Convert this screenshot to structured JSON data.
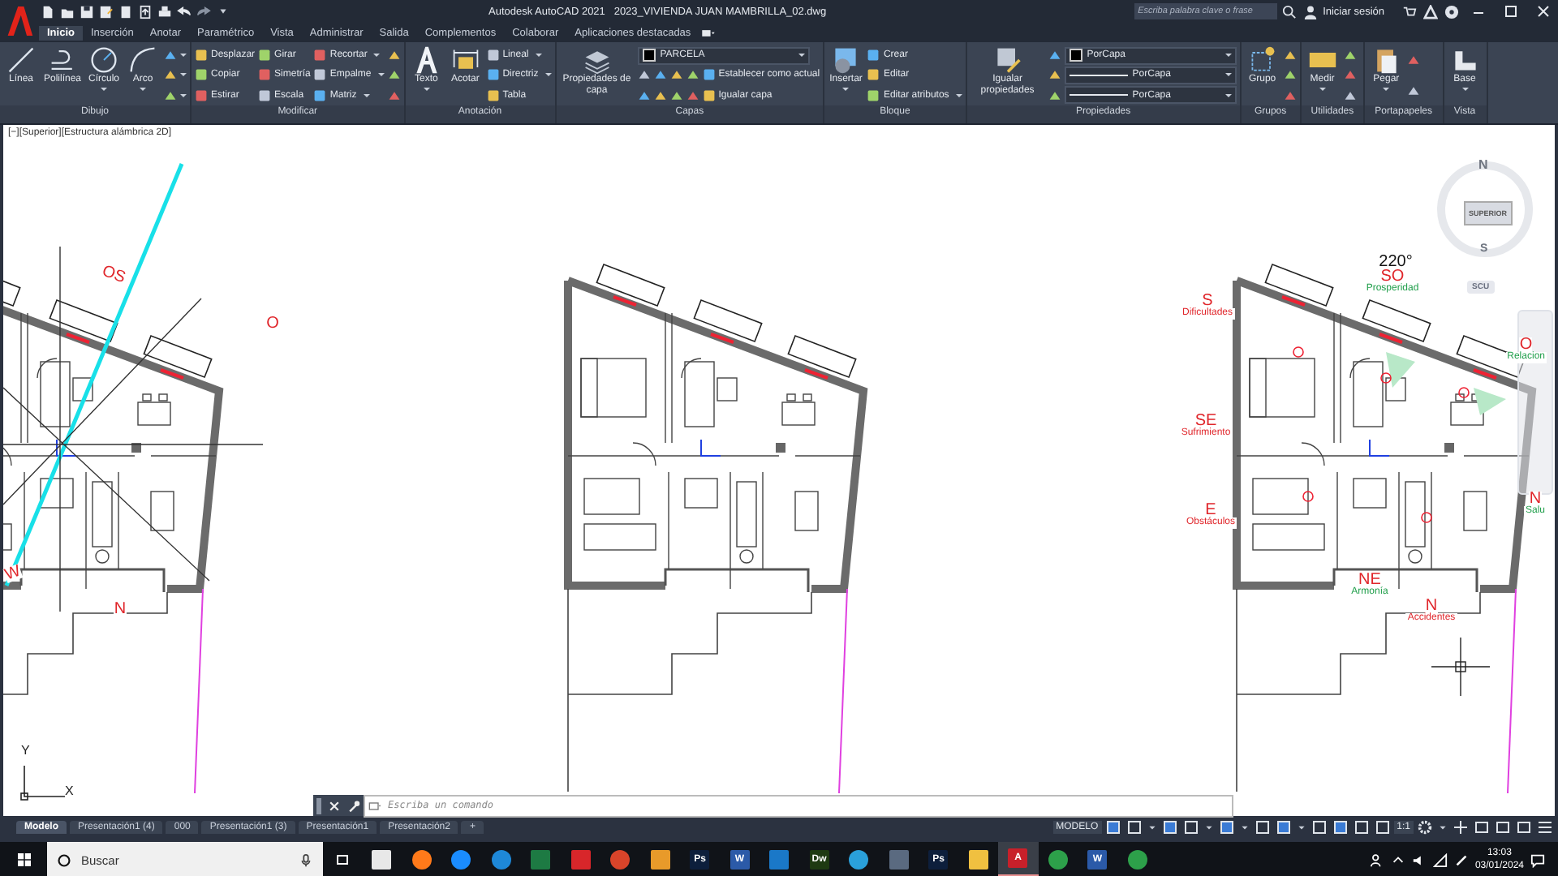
{
  "title_bar": {
    "app": "Autodesk AutoCAD 2021",
    "file": "2023_VIVIENDA JUAN MAMBRILLA_02.dwg",
    "search_placeholder": "Escriba palabra clave o frase",
    "sign_in": "Iniciar sesión"
  },
  "tabs": [
    {
      "label": "Inicio",
      "selected": true
    },
    {
      "label": "Inserción",
      "selected": false
    },
    {
      "label": "Anotar",
      "selected": false
    },
    {
      "label": "Paramétrico",
      "selected": false
    },
    {
      "label": "Vista",
      "selected": false
    },
    {
      "label": "Administrar",
      "selected": false
    },
    {
      "label": "Salida",
      "selected": false
    },
    {
      "label": "Complementos",
      "selected": false
    },
    {
      "label": "Colaborar",
      "selected": false
    },
    {
      "label": "Aplicaciones destacadas",
      "selected": false
    }
  ],
  "panels": [
    {
      "title": "Dibujo",
      "columns": [
        {
          "kind": "large",
          "label": "Línea",
          "caret": false
        },
        {
          "kind": "large",
          "label": "Polilínea",
          "caret": false
        },
        {
          "kind": "large",
          "label": "Círculo",
          "caret": true
        },
        {
          "kind": "large",
          "label": "Arco",
          "caret": true
        },
        {
          "kind": "stack",
          "rows": [
            [
              {
                "kind": "icon",
                "caret": true
              }
            ],
            [
              {
                "kind": "icon",
                "caret": true
              }
            ],
            [
              {
                "kind": "icon",
                "caret": true
              }
            ]
          ]
        }
      ]
    },
    {
      "title": "Modificar",
      "columns": [
        {
          "kind": "stack",
          "rows": [
            [
              {
                "kind": "tool",
                "label": "Desplazar",
                "caret": false
              }
            ],
            [
              {
                "kind": "tool",
                "label": "Copiar",
                "caret": false
              }
            ],
            [
              {
                "kind": "tool",
                "label": "Estirar",
                "caret": false
              }
            ]
          ]
        },
        {
          "kind": "stack",
          "rows": [
            [
              {
                "kind": "tool",
                "label": "Girar",
                "caret": false
              }
            ],
            [
              {
                "kind": "tool",
                "label": "Simetría",
                "caret": false
              }
            ],
            [
              {
                "kind": "tool",
                "label": "Escala",
                "caret": false
              }
            ]
          ]
        },
        {
          "kind": "stack",
          "rows": [
            [
              {
                "kind": "tool",
                "label": "Recortar",
                "caret": true
              }
            ],
            [
              {
                "kind": "tool",
                "label": "Empalme",
                "caret": true
              }
            ],
            [
              {
                "kind": "tool",
                "label": "Matriz",
                "caret": true
              }
            ]
          ]
        },
        {
          "kind": "stack",
          "rows": [
            [
              {
                "kind": "icon",
                "caret": false
              }
            ],
            [
              {
                "kind": "icon",
                "caret": false
              }
            ],
            [
              {
                "kind": "icon",
                "caret": false
              }
            ]
          ]
        }
      ]
    },
    {
      "title": "Anotación",
      "columns": [
        {
          "kind": "large",
          "label": "Texto",
          "caret": true
        },
        {
          "kind": "large",
          "label": "Acotar",
          "caret": false
        },
        {
          "kind": "stack",
          "rows": [
            [
              {
                "kind": "tool",
                "label": "Lineal",
                "caret": true
              }
            ],
            [
              {
                "kind": "tool",
                "label": "Directriz",
                "caret": true
              }
            ],
            [
              {
                "kind": "tool",
                "label": "Tabla",
                "caret": false
              }
            ]
          ]
        }
      ]
    },
    {
      "title": "Capas",
      "columns": [
        {
          "kind": "large",
          "label": "Propiedades de capa",
          "caret": false
        },
        {
          "kind": "stack",
          "rows": [
            [
              {
                "kind": "dropdown",
                "value": "PARCELA",
                "swatch": true,
                "line": false
              }
            ],
            [
              {
                "kind": "icon",
                "caret": false
              },
              {
                "kind": "icon",
                "caret": false
              },
              {
                "kind": "icon",
                "caret": false
              },
              {
                "kind": "icon",
                "caret": false
              },
              {
                "kind": "tool",
                "label": "Establecer como actual",
                "caret": false
              }
            ],
            [
              {
                "kind": "icon",
                "caret": false
              },
              {
                "kind": "icon",
                "caret": false
              },
              {
                "kind": "icon",
                "caret": false
              },
              {
                "kind": "icon",
                "caret": false
              },
              {
                "kind": "tool",
                "label": "Igualar capa",
                "caret": false
              }
            ]
          ]
        }
      ]
    },
    {
      "title": "Bloque",
      "columns": [
        {
          "kind": "large",
          "label": "Insertar",
          "caret": true
        },
        {
          "kind": "stack",
          "rows": [
            [
              {
                "kind": "tool",
                "label": "Crear",
                "caret": false
              }
            ],
            [
              {
                "kind": "tool",
                "label": "Editar",
                "caret": false
              }
            ],
            [
              {
                "kind": "tool",
                "label": "Editar atributos",
                "caret": true
              }
            ]
          ]
        }
      ]
    },
    {
      "title": "Propiedades",
      "columns": [
        {
          "kind": "large",
          "label": "Igualar propiedades",
          "caret": false
        },
        {
          "kind": "stack",
          "rows": [
            [
              {
                "kind": "icon",
                "caret": false
              },
              {
                "kind": "dropdown",
                "value": "PorCapa",
                "swatch": true,
                "line": false
              }
            ],
            [
              {
                "kind": "icon",
                "caret": false
              },
              {
                "kind": "dropdown",
                "value": "PorCapa",
                "swatch": false,
                "line": true
              }
            ],
            [
              {
                "kind": "icon",
                "caret": false
              },
              {
                "kind": "dropdown",
                "value": "PorCapa",
                "swatch": false,
                "line": true
              }
            ]
          ]
        }
      ]
    },
    {
      "title": "Grupos",
      "columns": [
        {
          "kind": "large",
          "label": "Grupo",
          "caret": false
        },
        {
          "kind": "stack",
          "rows": [
            [
              {
                "kind": "icon",
                "caret": false
              }
            ],
            [
              {
                "kind": "icon",
                "caret": false
              }
            ],
            [
              {
                "kind": "icon",
                "caret": false
              }
            ]
          ]
        }
      ]
    },
    {
      "title": "Utilidades",
      "columns": [
        {
          "kind": "large",
          "label": "Medir",
          "caret": true
        },
        {
          "kind": "stack",
          "rows": [
            [
              {
                "kind": "icon",
                "caret": false
              }
            ],
            [
              {
                "kind": "icon",
                "caret": false
              }
            ],
            [
              {
                "kind": "icon",
                "caret": false
              }
            ]
          ]
        }
      ]
    },
    {
      "title": "Portapapeles",
      "columns": [
        {
          "kind": "large",
          "label": "Pegar",
          "caret": true
        },
        {
          "kind": "stack",
          "rows": [
            [
              {
                "kind": "icon",
                "caret": false
              }
            ],
            [
              {
                "kind": "icon",
                "caret": false
              }
            ]
          ]
        }
      ]
    },
    {
      "title": "Vista",
      "columns": [
        {
          "kind": "large",
          "label": "Base",
          "caret": true
        }
      ]
    }
  ],
  "drawing": {
    "viewport_label": "[−][Superior][Estructura alámbrica 2D]",
    "left_plan": {
      "labels": [
        {
          "text": "OS",
          "color": "#e0262b"
        },
        {
          "text": "O",
          "color": "#e0262b"
        },
        {
          "text": "N",
          "color": "#e0262b"
        },
        {
          "text": "W",
          "color": "#e0262b"
        }
      ]
    },
    "right_plan": {
      "labels": [
        {
          "text": "220°",
          "color": "#111111"
        },
        {
          "text": "SO",
          "sub": "Prosperidad",
          "color": "#1f9e4a"
        },
        {
          "text": "S",
          "sub": "Dificultades",
          "color": "#e0262b"
        },
        {
          "text": "SE",
          "sub": "Sufrimiento",
          "color": "#e0262b"
        },
        {
          "text": "E",
          "sub": "Obstáculos",
          "color": "#e0262b"
        },
        {
          "text": "NE",
          "sub": "Armonía",
          "color": "#1f9e4a"
        },
        {
          "text": "N",
          "sub": "Accidentes",
          "color": "#e0262b"
        },
        {
          "text": "O",
          "sub": "Relacion",
          "color": "#1f9e4a"
        },
        {
          "text": "N",
          "sub": "Salu",
          "color": "#1f9e4a"
        }
      ]
    },
    "viewcube": {
      "north": "N",
      "face": "SUPERIOR",
      "south": "S",
      "ucs": "SCU"
    },
    "ucs_icon": {
      "y": "Y",
      "x": "X"
    },
    "command_line": {
      "placeholder": "Escriba un comando"
    }
  },
  "layout_tabs": [
    {
      "label": "Modelo",
      "selected": true
    },
    {
      "label": "Presentación1 (4)",
      "selected": false
    },
    {
      "label": "000",
      "selected": false
    },
    {
      "label": "Presentación1 (3)",
      "selected": false
    },
    {
      "label": "Presentación1",
      "selected": false
    },
    {
      "label": "Presentación2",
      "selected": false
    }
  ],
  "add_tab": "+",
  "status_bar": {
    "model": "MODELO",
    "scale": "1:1"
  },
  "taskbar": {
    "search_placeholder": "Buscar",
    "apps": [
      {
        "kind": "tile",
        "color": "#e8e8e8",
        "active": false
      },
      {
        "kind": "round",
        "color": "#ff7a1a",
        "active": false
      },
      {
        "kind": "round",
        "color": "#1a8cff",
        "active": false
      },
      {
        "kind": "round",
        "color": "#1e88d8",
        "active": false
      },
      {
        "kind": "tile",
        "color": "#1d7a43",
        "active": false
      },
      {
        "kind": "tile",
        "color": "#d8262a",
        "active": false
      },
      {
        "kind": "round",
        "color": "#d8442a",
        "active": false
      },
      {
        "kind": "tile",
        "color": "#e89a2a",
        "active": false
      },
      {
        "kind": "tile",
        "color": "#0d1f3c",
        "label": "Ps",
        "active": false
      },
      {
        "kind": "tile",
        "color": "#2b5aa8",
        "label": "W",
        "active": false
      },
      {
        "kind": "tile",
        "color": "#1a78c8",
        "active": false
      },
      {
        "kind": "tile",
        "color": "#1e3a12",
        "label": "Dw",
        "active": false
      },
      {
        "kind": "round",
        "color": "#2aa0da",
        "active": false
      },
      {
        "kind": "tile",
        "color": "#5a6a80",
        "active": false
      },
      {
        "kind": "tile",
        "color": "#0d1f3c",
        "label": "Ps",
        "active": false
      },
      {
        "kind": "tile",
        "color": "#f0c040",
        "active": false
      },
      {
        "kind": "tile",
        "color": "#c8202a",
        "label": "A",
        "active": true
      },
      {
        "kind": "round",
        "color": "#2da04a",
        "active": false
      },
      {
        "kind": "tile",
        "color": "#2b5aa8",
        "label": "W",
        "active": false
      },
      {
        "kind": "round",
        "color": "#2da04a",
        "active": false
      }
    ],
    "time": "13:03",
    "date": "03/01/2024"
  }
}
